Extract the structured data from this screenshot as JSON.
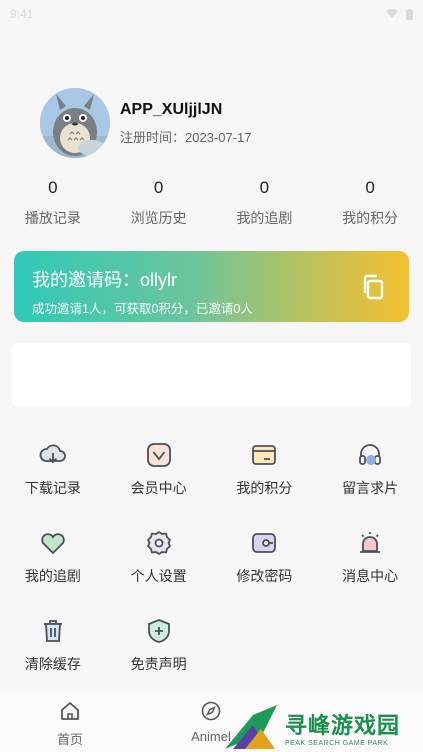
{
  "status_bar": {
    "time": "9:41"
  },
  "profile": {
    "username": "APP_XUljjlJN",
    "reg_label": "注册时间：",
    "reg_date": "2023-07-17"
  },
  "stats": [
    {
      "value": "0",
      "label": "播放记录"
    },
    {
      "value": "0",
      "label": "浏览历史"
    },
    {
      "value": "0",
      "label": "我的追剧"
    },
    {
      "value": "0",
      "label": "我的积分"
    }
  ],
  "invite": {
    "title": "我的邀请码：ollylr",
    "subtitle": "成功邀请1人，可获取0积分，已邀请0人"
  },
  "menu": [
    {
      "label": "下载记录",
      "icon": "cloud-download-icon"
    },
    {
      "label": "会员中心",
      "icon": "vip-diamond-icon"
    },
    {
      "label": "我的积分",
      "icon": "wallet-card-icon"
    },
    {
      "label": "留言求片",
      "icon": "headset-icon"
    },
    {
      "label": "我的追剧",
      "icon": "heart-icon"
    },
    {
      "label": "个人设置",
      "icon": "gear-icon"
    },
    {
      "label": "修改密码",
      "icon": "lock-icon"
    },
    {
      "label": "消息中心",
      "icon": "bell-icon"
    },
    {
      "label": "清除缓存",
      "icon": "trash-icon"
    },
    {
      "label": "免责声明",
      "icon": "shield-icon"
    }
  ],
  "tabbar": [
    {
      "label": "首页",
      "icon": "home-icon"
    },
    {
      "label": "Animel",
      "icon": "compass-icon"
    }
  ],
  "watermark": {
    "main": "寻峰游戏园",
    "sub": "PEAK SEARCH GAME PARK"
  },
  "colors": {
    "accent": "#2fc9b8",
    "brand_green": "#1a8f4e"
  }
}
